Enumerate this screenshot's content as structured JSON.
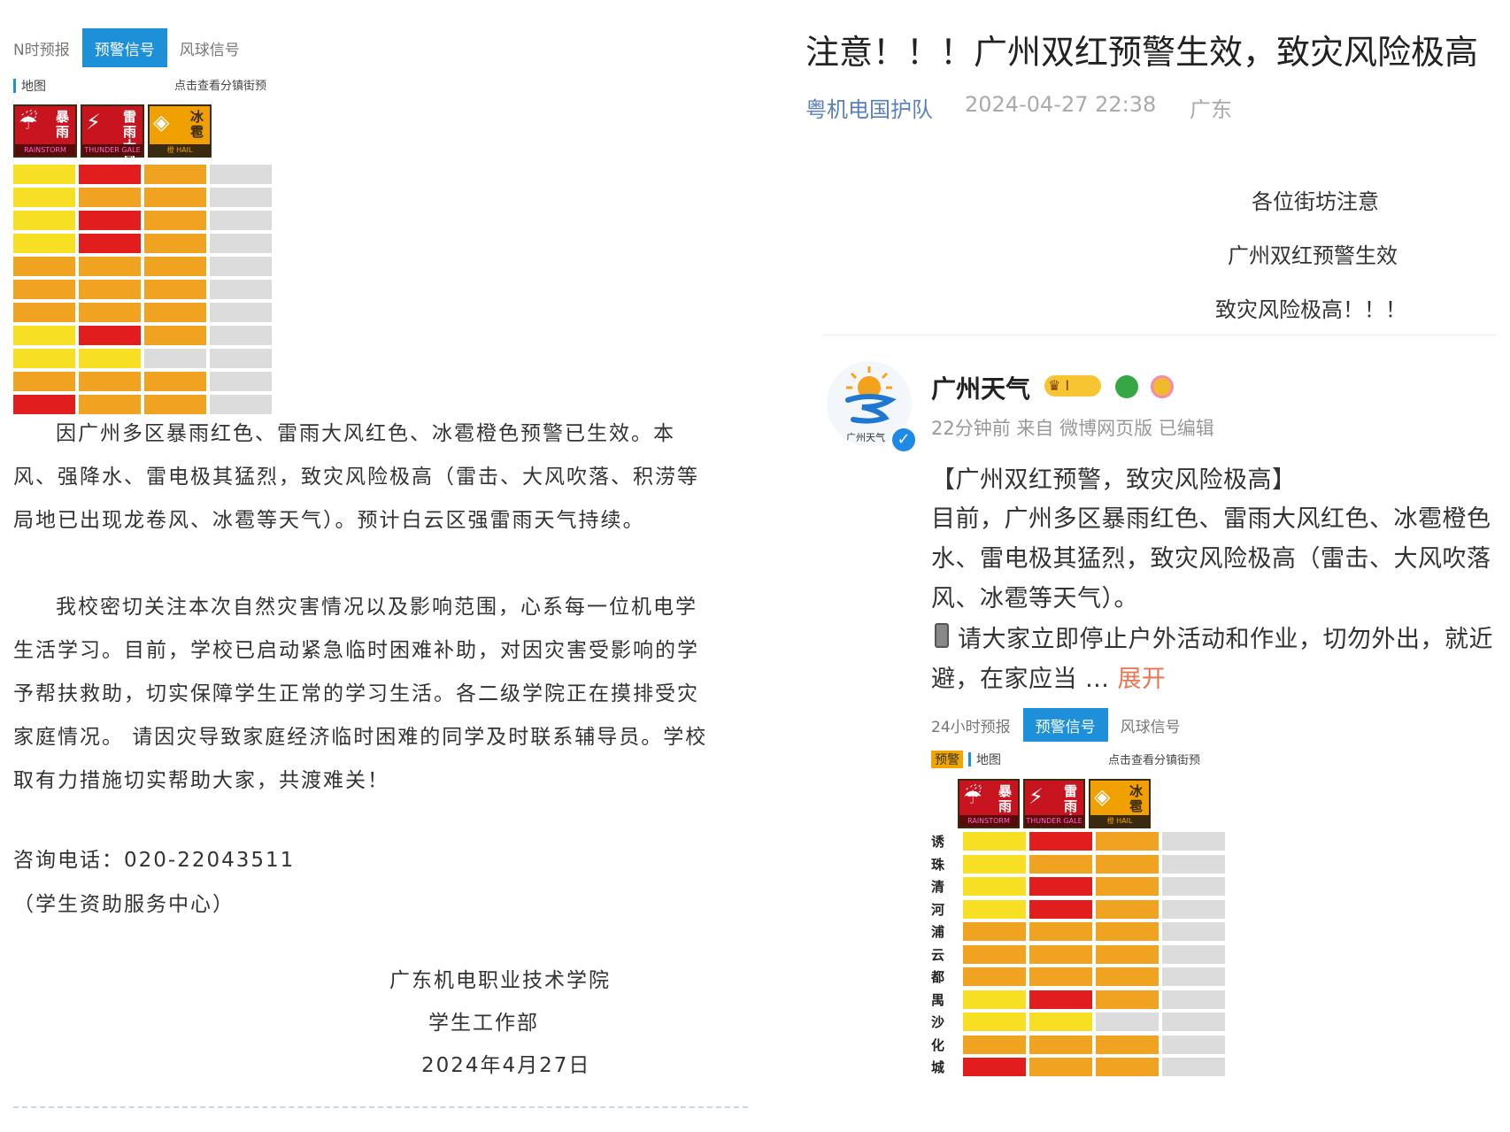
{
  "left_widget": {
    "tabs": [
      "N时预报",
      "预警信号",
      "风球信号"
    ],
    "active_tab": 1,
    "sub_first": "",
    "sub_label": "地图",
    "link": "点击查看分镇街预",
    "icons": [
      {
        "name": "rainstorm-warning-icon",
        "color": "red",
        "glyph": "☔",
        "text": "暴雨",
        "bottom": "RAINSTORM"
      },
      {
        "name": "thunderstorm-gale-warning-icon",
        "color": "red",
        "glyph": "⚡",
        "text": "雷雨大风",
        "bottom": "THUNDER GALE"
      },
      {
        "name": "hail-warning-icon",
        "color": "orange",
        "glyph": "◈",
        "text": "冰雹",
        "bottom": "橙 HAIL"
      }
    ],
    "row_labels": [],
    "rows": [
      [
        "yellow",
        "red",
        "orange",
        "gray"
      ],
      [
        "yellow",
        "orange",
        "orange",
        "gray"
      ],
      [
        "yellow",
        "red",
        "orange",
        "gray"
      ],
      [
        "yellow",
        "red",
        "orange",
        "gray"
      ],
      [
        "orange",
        "orange",
        "orange",
        "gray"
      ],
      [
        "orange",
        "orange",
        "orange",
        "gray"
      ],
      [
        "orange",
        "orange",
        "orange",
        "gray"
      ],
      [
        "yellow",
        "red",
        "orange",
        "gray"
      ],
      [
        "yellow",
        "yellow",
        "gray",
        "gray"
      ],
      [
        "orange",
        "orange",
        "orange",
        "gray"
      ],
      [
        "red",
        "orange",
        "orange",
        "gray"
      ]
    ]
  },
  "left_article": {
    "para1": [
      "因广州多区暴雨红色、雷雨大风红色、冰雹橙色预警已生效。本",
      "风、强降水、雷电极其猛烈，致灾风险极高（雷击、大风吹落、积涝等",
      "局地已出现龙卷风、冰雹等天气）。预计白云区强雷雨天气持续。"
    ],
    "para2": [
      "我校密切关注本次自然灾害情况以及影响范围，心系每一位机电学",
      "生活学习。目前，学校已启动紧急临时困难补助，对因灾害受影响的学",
      "予帮扶救助，切实保障学生正常的学习生活。各二级学院正在摸排受灾",
      "家庭情况。 请因灾导致家庭经济临时困难的同学及时联系辅导员。学校",
      "取有力措施切实帮助大家，共渡难关！"
    ],
    "phone": "咨询电话：020-22043511",
    "phone_note": "（学生资助服务中心）",
    "sign_org": "广东机电职业技术学院",
    "sign_dept": "学生工作部",
    "sign_date": "2024年4月27日"
  },
  "right_article": {
    "title": "注意！！！广州双红预警生效，致灾风险极高",
    "author": "粤机电国护队",
    "datetime": "2024-04-27 22:38",
    "region": "广东",
    "center_lines": [
      "各位街坊注意",
      "广州双红预警生效",
      "致灾风险极高！！！"
    ]
  },
  "weibo": {
    "account": "广州天气",
    "avatar_caption": "广州天气",
    "meta": "22分钟前  来自 微博网页版  已编辑",
    "lines": [
      "【广州双红预警，致灾风险极高】",
      "目前，广州多区暴雨红色、雷雨大风红色、冰雹橙色",
      "水、雷电极其猛烈，致灾风险极高（雷击、大风吹落",
      "风、冰雹等天气）。",
      "请大家立即停止户外活动和作业，切勿外出，就近",
      "避，在家应当 ..."
    ],
    "expand": "展开"
  },
  "right_widget": {
    "tabs": [
      "24小时预报",
      "预警信号",
      "风球信号"
    ],
    "active_tab": 1,
    "sub_first": "预警",
    "sub_label": "地图",
    "link": "点击查看分镇街预",
    "icons": [
      {
        "name": "rainstorm-warning-icon",
        "color": "red",
        "glyph": "☔",
        "text": "暴雨",
        "bottom": "RAINSTORM"
      },
      {
        "name": "thunderstorm-gale-warning-icon",
        "color": "red",
        "glyph": "⚡",
        "text": "雷雨大风",
        "bottom": "THUNDER GALE"
      },
      {
        "name": "hail-warning-icon",
        "color": "orange",
        "glyph": "◈",
        "text": "冰雹",
        "bottom": "橙 HAIL"
      }
    ],
    "row_labels": [
      "诱",
      "珠",
      "清",
      "河",
      "浦",
      "云",
      "都",
      "禺",
      "沙",
      "化",
      "城"
    ],
    "rows": [
      [
        "yellow",
        "red",
        "orange",
        "gray"
      ],
      [
        "yellow",
        "orange",
        "orange",
        "gray"
      ],
      [
        "yellow",
        "red",
        "orange",
        "gray"
      ],
      [
        "yellow",
        "red",
        "orange",
        "gray"
      ],
      [
        "orange",
        "orange",
        "orange",
        "gray"
      ],
      [
        "orange",
        "orange",
        "orange",
        "gray"
      ],
      [
        "orange",
        "orange",
        "orange",
        "gray"
      ],
      [
        "yellow",
        "red",
        "orange",
        "gray"
      ],
      [
        "yellow",
        "yellow",
        "gray",
        "gray"
      ],
      [
        "orange",
        "orange",
        "orange",
        "gray"
      ],
      [
        "red",
        "orange",
        "orange",
        "gray"
      ]
    ]
  },
  "colors": {
    "tab_active": "#1e90d9",
    "link_blue": "#5a80b8",
    "expand_orange": "#eb7350",
    "warn_red": "#e11d1d",
    "warn_orange": "#f0a320",
    "warn_yellow": "#f7e023"
  }
}
